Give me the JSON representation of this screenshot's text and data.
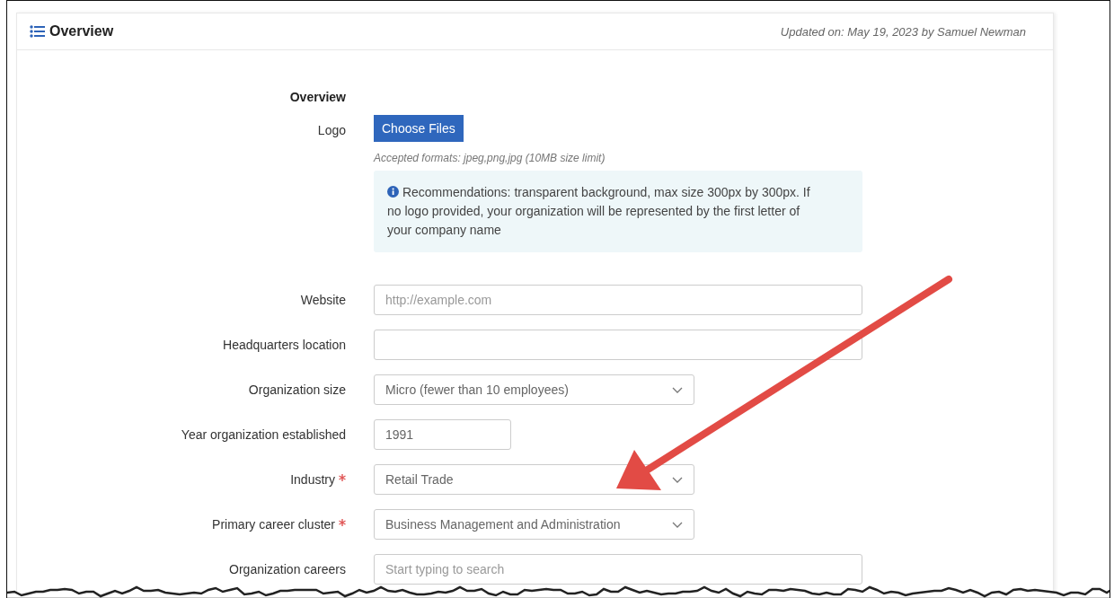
{
  "header": {
    "title": "Overview",
    "updated": "Updated on: May 19, 2023 by Samuel Newman"
  },
  "section_title": "Overview",
  "logo": {
    "label": "Logo",
    "button": "Choose Files",
    "hint": "Accepted formats: jpeg,png,jpg (10MB size limit)",
    "info": "Recommendations: transparent background, max size 300px by 300px. If no logo provided, your organization will be represented by the first letter of your company name"
  },
  "fields": [
    {
      "label": "Website",
      "kind": "text",
      "required": false,
      "placeholder": "http://example.com"
    },
    {
      "label": "Headquarters location",
      "kind": "text",
      "required": false
    },
    {
      "label": "Organization size",
      "kind": "select",
      "required": false,
      "value": "Micro (fewer than 10 employees)"
    },
    {
      "label": "Year organization established",
      "kind": "number",
      "required": false,
      "value": "1991"
    },
    {
      "label": "Industry",
      "kind": "select",
      "required": true,
      "value": "Retail Trade"
    },
    {
      "label": "Primary career cluster",
      "kind": "select",
      "required": true,
      "value": "Business Management and Administration"
    },
    {
      "label": "Organization careers",
      "kind": "text",
      "required": false,
      "placeholder": "Start typing to search"
    }
  ]
}
